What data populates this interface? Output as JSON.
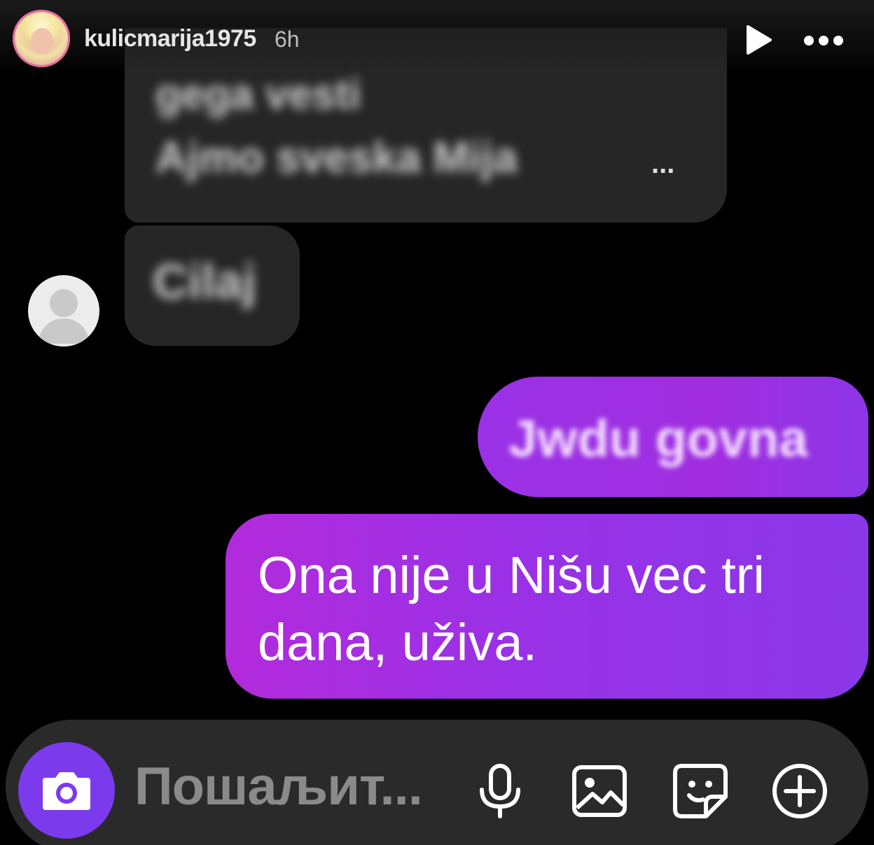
{
  "header": {
    "username": "kulicmarija1975",
    "time": "6h"
  },
  "messages": {
    "received_1_line1": "gega vesti",
    "received_1_line2": "Ajmo sveska Mija",
    "received_1_ellipsis": "...",
    "received_2": "Cilaj",
    "sent_1": "Jwdu govna",
    "sent_2": "Ona nije u Nišu vec tri dana, uživa."
  },
  "composer": {
    "placeholder": "Пошаљит..."
  },
  "icons": {
    "play": "play-icon",
    "more": "more-horizontal-icon",
    "camera": "camera-icon",
    "mic": "microphone-icon",
    "gallery": "image-icon",
    "sticker": "sticker-icon",
    "plus": "plus-circle-icon"
  },
  "colors": {
    "sent_bubble": "#9a31e6",
    "received_bubble": "#262626",
    "camera_button": "#7c3aed",
    "composer_bg": "#2a2a2a"
  }
}
